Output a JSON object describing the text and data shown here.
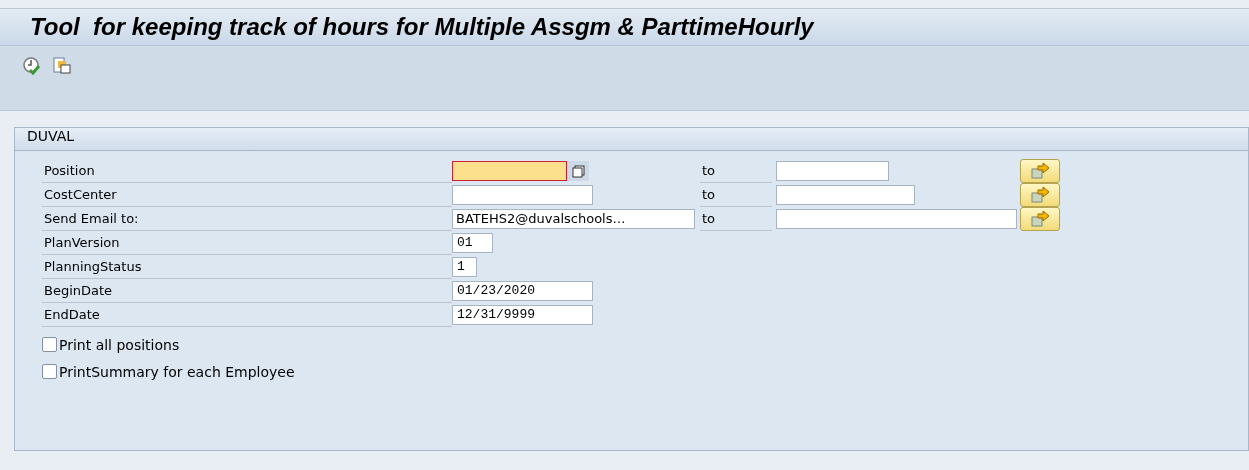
{
  "window": {
    "title": "Tool  for keeping track of hours for Multiple Assgm & ParttimeHourly"
  },
  "toolbar": {
    "buttons": [
      {
        "kind": "execute"
      },
      {
        "kind": "copy"
      }
    ]
  },
  "group": {
    "title": "DUVAL",
    "rows": [
      {
        "kind": "range",
        "label": "Position",
        "value": "",
        "focused": true,
        "matchcode": true,
        "to_label": "to",
        "to_value": ""
      },
      {
        "kind": "range",
        "label": "CostCenter",
        "value": "",
        "focused": false,
        "matchcode": false,
        "to_label": "to",
        "to_value": ""
      },
      {
        "kind": "range",
        "label": "Send Email to:",
        "value": "BATEHS2@duvalschools…",
        "focused": false,
        "matchcode": false,
        "to_label": "to",
        "to_value": ""
      },
      {
        "kind": "single",
        "label": "PlanVersion",
        "value": "01"
      },
      {
        "kind": "single",
        "label": "PlanningStatus",
        "value": "1"
      },
      {
        "kind": "single",
        "label": "BeginDate",
        "value": "01/23/2020"
      },
      {
        "kind": "single",
        "label": "EndDate",
        "value": "12/31/9999"
      },
      {
        "kind": "checkbox",
        "label": "Print all positions",
        "checked": false
      },
      {
        "kind": "checkbox",
        "label": "PrintSummary for each Employee",
        "checked": false
      }
    ]
  }
}
